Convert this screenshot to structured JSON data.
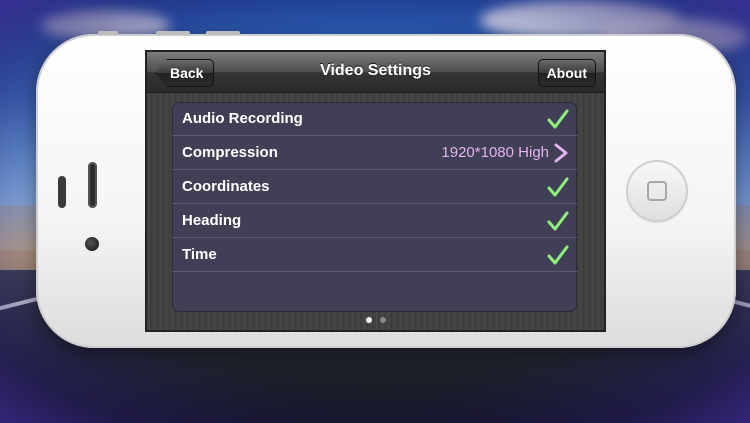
{
  "app": {
    "title": "Video Settings",
    "back_label": "Back",
    "about_label": "About"
  },
  "settings": [
    {
      "label": "Audio Recording",
      "accessory": "check-icon",
      "value": ""
    },
    {
      "label": "Compression",
      "accessory": "chevron-right-icon",
      "value": "1920*1080 High"
    },
    {
      "label": "Coordinates",
      "accessory": "check-icon",
      "value": ""
    },
    {
      "label": "Heading",
      "accessory": "check-icon",
      "value": ""
    },
    {
      "label": "Time",
      "accessory": "check-icon",
      "value": ""
    }
  ],
  "page_control": {
    "pages": 2,
    "current": 1
  },
  "colors": {
    "check": "#8ef07a",
    "value_text": "#e3b3f0",
    "table_bg": "#403f55"
  }
}
